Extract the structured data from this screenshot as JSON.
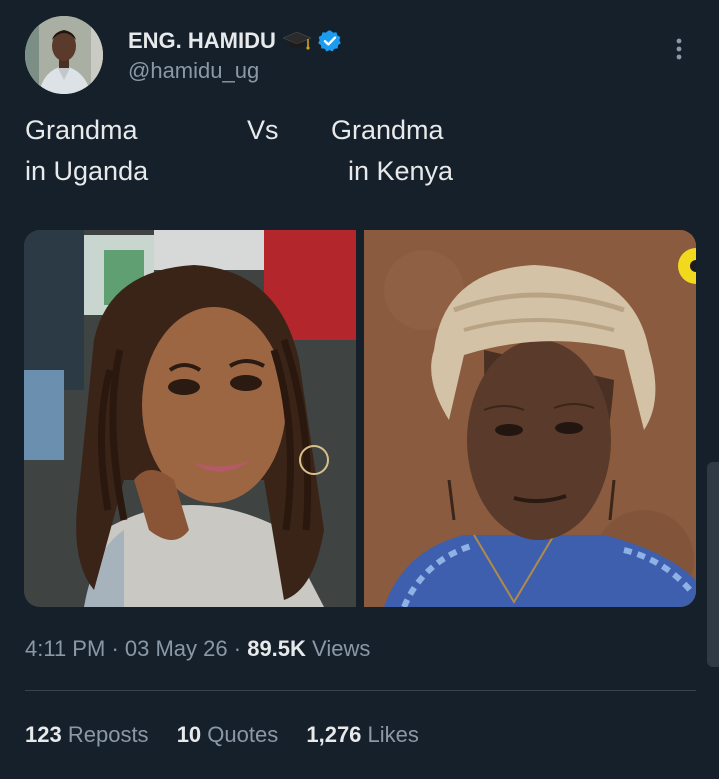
{
  "tweet": {
    "author_name": "ENG. HAMIDU",
    "author_handle": "@hamidu_ug",
    "text_left_line1": "Grandma",
    "text_left_line2": "in Uganda",
    "text_vs": "Vs",
    "text_right_line1": "Grandma",
    "text_right_line2": "in Kenya",
    "time": "4:11 PM",
    "date": "03 May 26",
    "views_count": "89.5K",
    "views_label": "Views",
    "reposts_count": "123",
    "reposts_label": "Reposts",
    "quotes_count": "10",
    "quotes_label": "Quotes",
    "likes_count": "1,276",
    "likes_label": "Likes"
  },
  "icons": {
    "graduation_cap": "graduation-cap-icon",
    "verified": "verified-badge-icon",
    "more": "more-vertical-icon"
  },
  "colors": {
    "background": "#15202b",
    "primary_text": "#e7e9ea",
    "secondary_text": "#8b98a5",
    "divider": "#38444d",
    "verified_blue": "#1d9bf0"
  }
}
